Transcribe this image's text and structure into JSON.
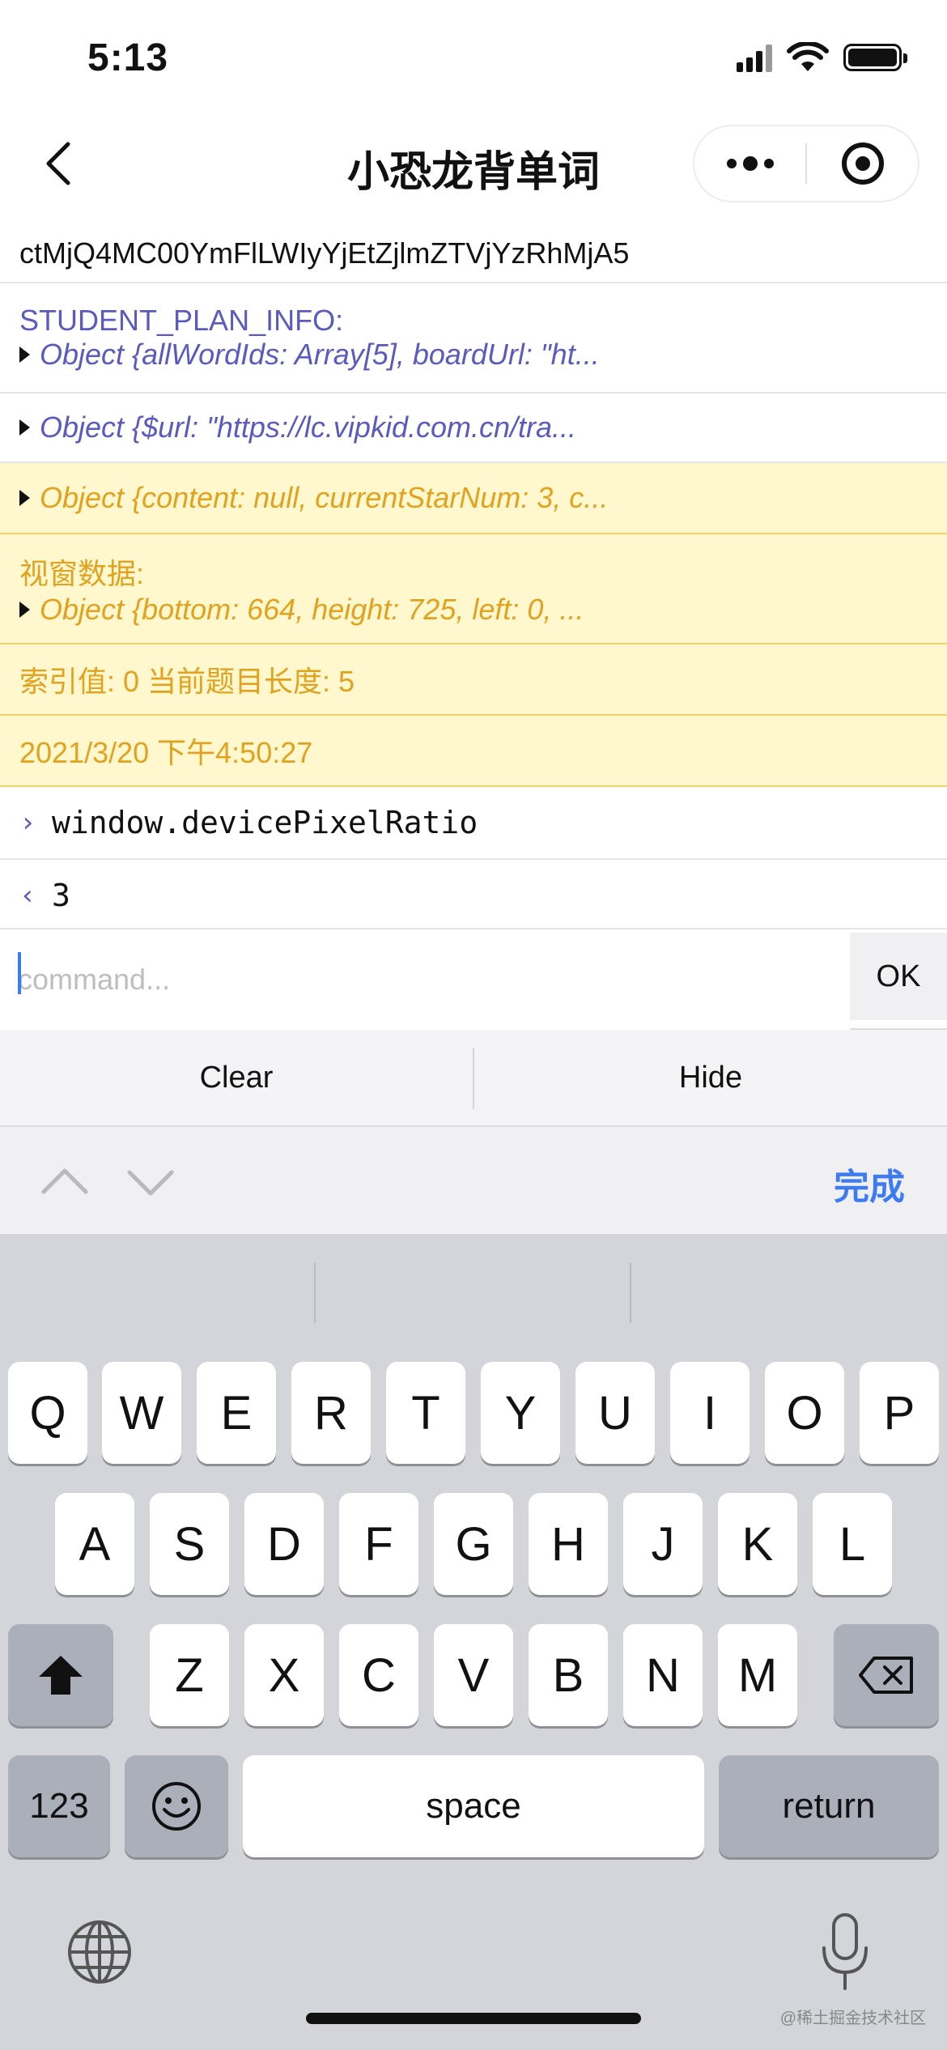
{
  "status_bar": {
    "time": "5:13"
  },
  "nav": {
    "title": "小恐龙背单词"
  },
  "console": {
    "partial_row": {
      "cut_text": "",
      "text": "ctMjQ4MC00YmFlLWIyYjEtZjlmZTVjYzRhMjA5"
    },
    "student_plan": {
      "label": "STUDENT_PLAN_INFO:",
      "object": "Object {allWordIds: Array[5], boardUrl: \"ht..."
    },
    "url_object": "Object {$url: \"https://lc.vipkid.com.cn/tra...",
    "warn_object": "Object {content: null, currentStarNum: 3, c...",
    "viewport": {
      "label": "视窗数据:",
      "object": "Object {bottom: 664, height: 725, left: 0, ..."
    },
    "index_info": "索引值: 0 当前题目长度: 5",
    "timestamp": "2021/3/20 下午4:50:27",
    "command": {
      "prompt": "›",
      "text": "window.devicePixelRatio"
    },
    "result": {
      "prompt": "‹",
      "text": "3"
    }
  },
  "command_input": {
    "placeholder": "command...",
    "value": "",
    "ok_label": "OK"
  },
  "toolbar": {
    "clear_label": "Clear",
    "hide_label": "Hide"
  },
  "accessory": {
    "done_label": "完成"
  },
  "keyboard": {
    "row1": [
      "Q",
      "W",
      "E",
      "R",
      "T",
      "Y",
      "U",
      "I",
      "O",
      "P"
    ],
    "row2": [
      "A",
      "S",
      "D",
      "F",
      "G",
      "H",
      "J",
      "K",
      "L"
    ],
    "row3": [
      "Z",
      "X",
      "C",
      "V",
      "B",
      "N",
      "M"
    ],
    "numbers_label": "123",
    "space_label": "space",
    "return_label": "return"
  },
  "watermark": "@稀土掘金技术社区",
  "colors": {
    "accent": "#3d7bf5",
    "log_info": "#5a5ac0",
    "log_warn": "#e2a21e",
    "warn_bg": "#fff8cf"
  }
}
